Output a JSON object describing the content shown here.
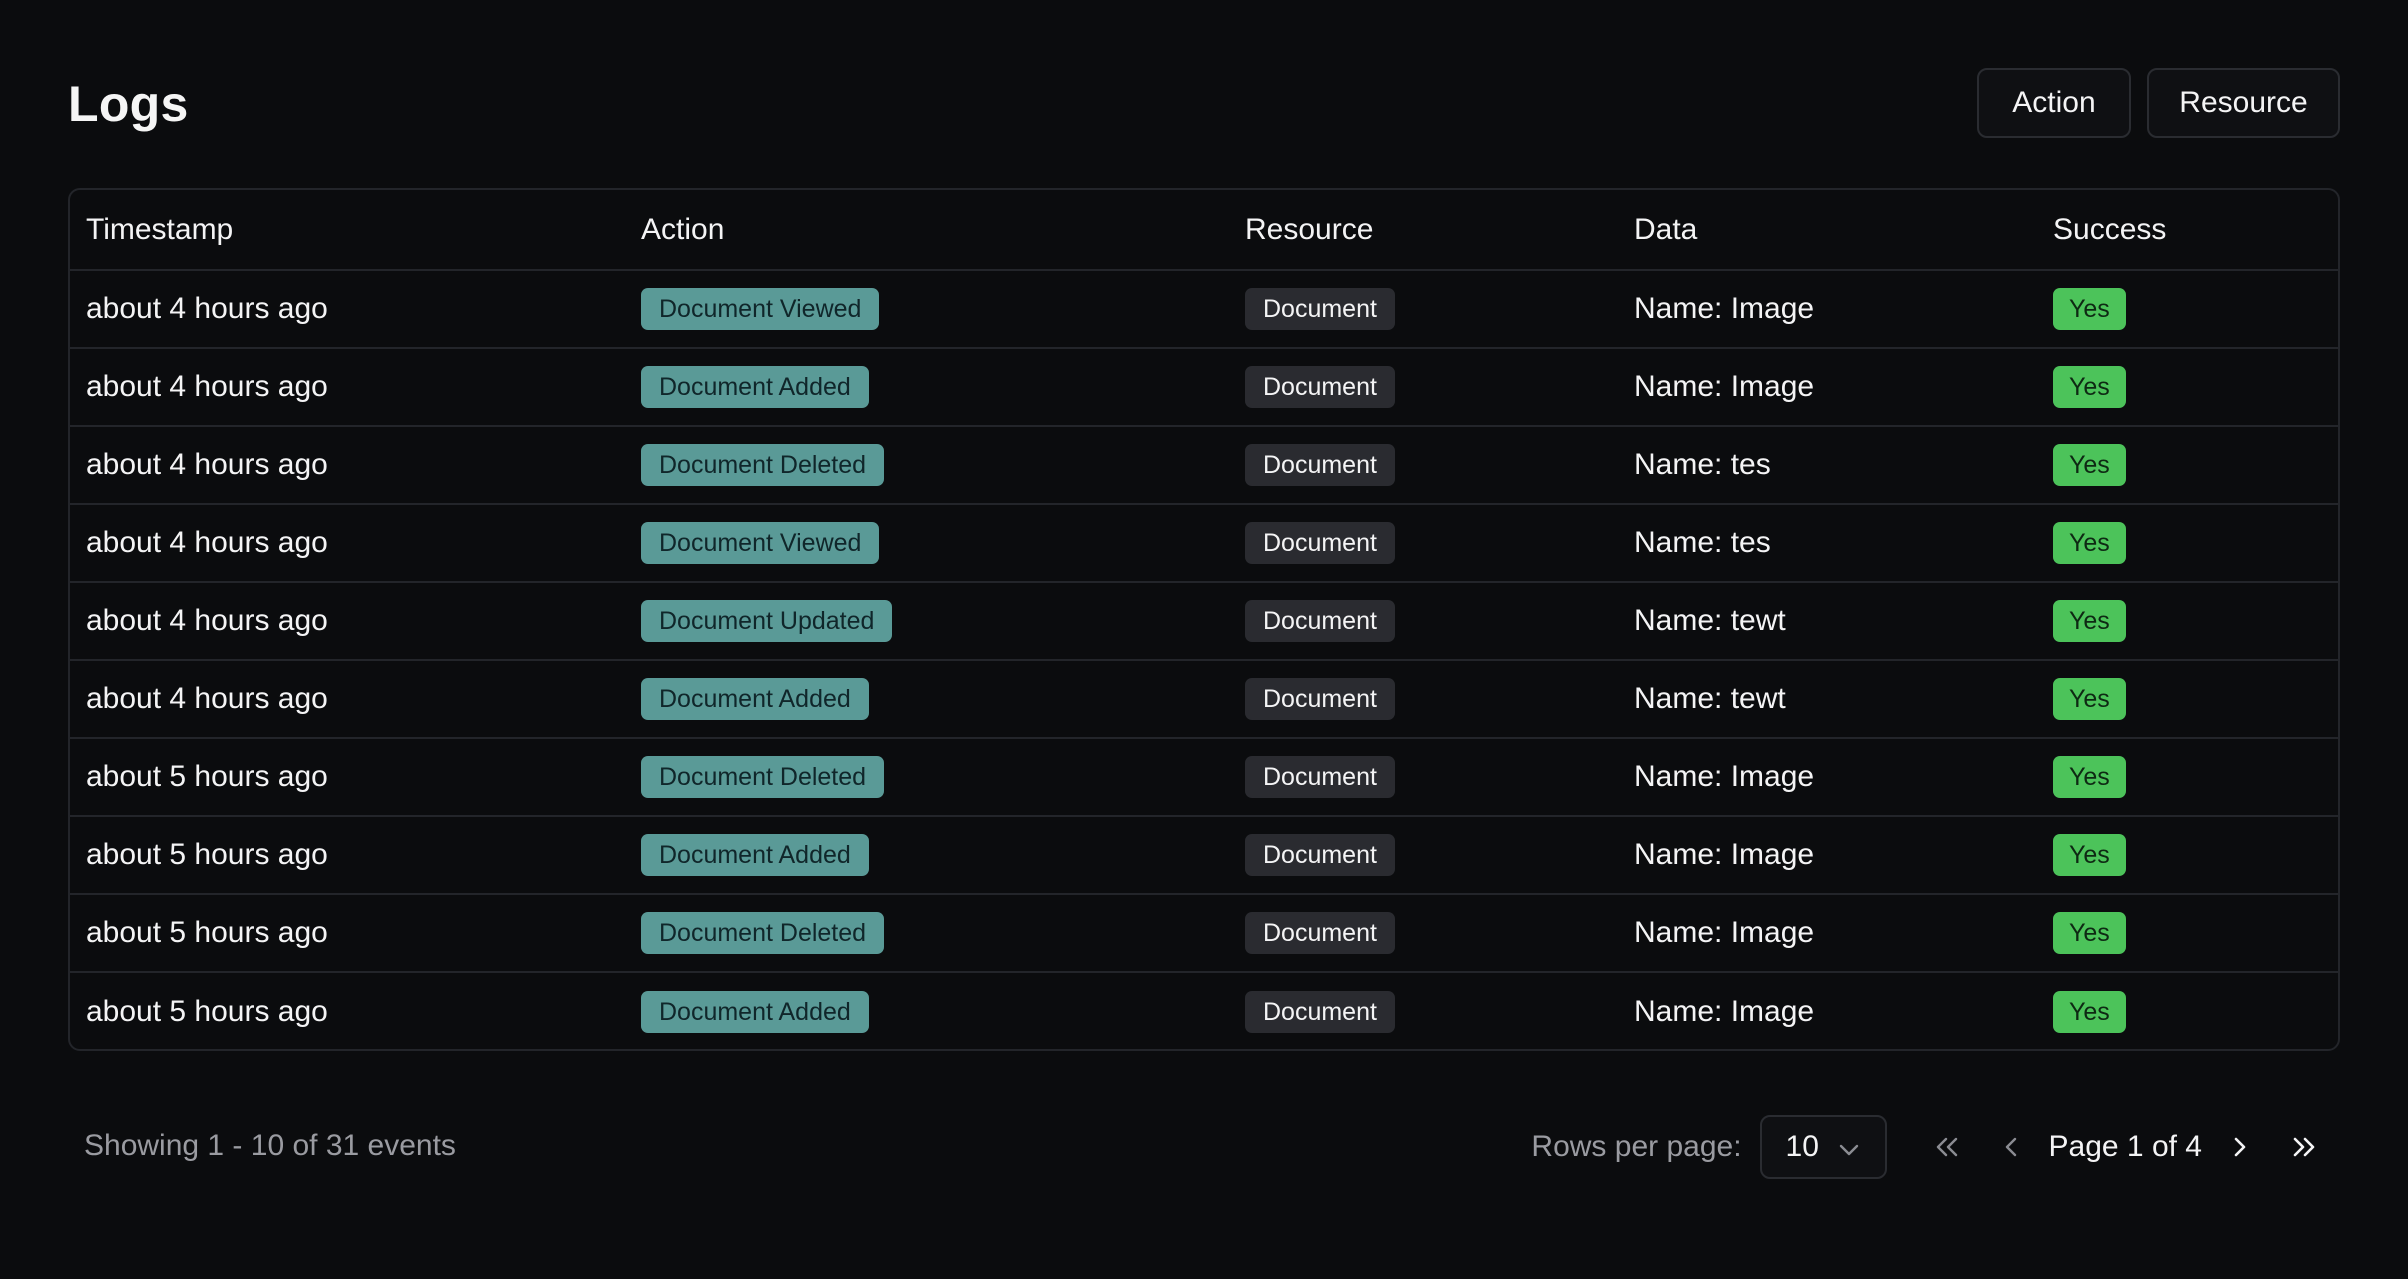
{
  "header": {
    "title": "Logs",
    "filters": {
      "action_label": "Action",
      "resource_label": "Resource"
    }
  },
  "table": {
    "columns": {
      "timestamp": "Timestamp",
      "action": "Action",
      "resource": "Resource",
      "data": "Data",
      "success": "Success"
    },
    "rows": [
      {
        "timestamp": "about 4 hours ago",
        "action": "Document Viewed",
        "resource": "Document",
        "data": "Name: Image",
        "success": "Yes"
      },
      {
        "timestamp": "about 4 hours ago",
        "action": "Document Added",
        "resource": "Document",
        "data": "Name: Image",
        "success": "Yes"
      },
      {
        "timestamp": "about 4 hours ago",
        "action": "Document Deleted",
        "resource": "Document",
        "data": "Name: tes",
        "success": "Yes"
      },
      {
        "timestamp": "about 4 hours ago",
        "action": "Document Viewed",
        "resource": "Document",
        "data": "Name: tes",
        "success": "Yes"
      },
      {
        "timestamp": "about 4 hours ago",
        "action": "Document Updated",
        "resource": "Document",
        "data": "Name: tewt",
        "success": "Yes"
      },
      {
        "timestamp": "about 4 hours ago",
        "action": "Document Added",
        "resource": "Document",
        "data": "Name: tewt",
        "success": "Yes"
      },
      {
        "timestamp": "about 5 hours ago",
        "action": "Document Deleted",
        "resource": "Document",
        "data": "Name: Image",
        "success": "Yes"
      },
      {
        "timestamp": "about 5 hours ago",
        "action": "Document Added",
        "resource": "Document",
        "data": "Name: Image",
        "success": "Yes"
      },
      {
        "timestamp": "about 5 hours ago",
        "action": "Document Deleted",
        "resource": "Document",
        "data": "Name: Image",
        "success": "Yes"
      },
      {
        "timestamp": "about 5 hours ago",
        "action": "Document Added",
        "resource": "Document",
        "data": "Name: Image",
        "success": "Yes"
      }
    ]
  },
  "footer": {
    "showing": "Showing 1 - 10 of 31 events",
    "rows_per_page_label": "Rows per page:",
    "rows_per_page_value": "10",
    "page_label": "Page 1 of 4",
    "icons": {
      "select": "chevron-down-icon",
      "first": "chevrons-left-icon",
      "prev": "chevron-left-icon",
      "next": "chevron-right-icon",
      "last": "chevrons-right-icon"
    }
  },
  "colors": {
    "background": "#0b0c0e",
    "action_badge": "#5a9a97",
    "resource_badge": "#2a2b30",
    "success_badge": "#4cc35a"
  }
}
